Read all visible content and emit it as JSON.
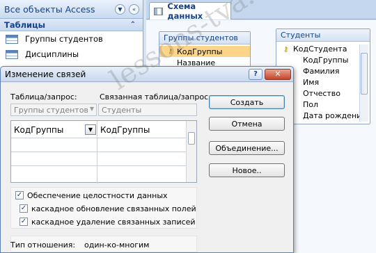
{
  "nav": {
    "header_title": "Все объекты Access",
    "section_title": "Таблицы",
    "items": [
      {
        "label": "Группы студентов"
      },
      {
        "label": "Дисциплины"
      }
    ]
  },
  "document": {
    "tab_label": "Схема данных",
    "field_lists": [
      {
        "title": "Группы студентов",
        "fields": [
          "КодГруппы",
          "Название"
        ],
        "key_field": "КодГруппы"
      },
      {
        "title": "Студенты",
        "fields": [
          "КодСтудента",
          "КодГруппы",
          "Фамилия",
          "Имя",
          "Отчество",
          "Пол",
          "Дата рождения"
        ],
        "key_field": "КодСтудента"
      }
    ]
  },
  "dialog": {
    "title": "Изменение связей",
    "help_label": "?",
    "close_label": "✕",
    "table_label": "Таблица/запрос:",
    "related_label": "Связанная таблица/запрос:",
    "table_value": "Группы студентов",
    "related_value": "Студенты",
    "grid_rows": [
      {
        "left": "КодГруппы",
        "right": "КодГруппы"
      }
    ],
    "checkboxes": [
      {
        "label": "Обеспечение целостности данных",
        "checked": true
      },
      {
        "label": "каскадное обновление связанных полей",
        "checked": true
      },
      {
        "label": "каскадное удаление связанных записей",
        "checked": true
      }
    ],
    "relation_type_label": "Тип отношения:",
    "relation_type_value": "один-ко-многим",
    "buttons": {
      "create": "Создать",
      "cancel": "Отмена",
      "join": "Объединение...",
      "new": "Новое.."
    }
  },
  "watermark": "lessons-tva.info",
  "icons": {
    "nav_menu": "chevron-down-icon",
    "nav_collapse": "chevron-left-icon",
    "section_collapse": "double-chevron-up-icon",
    "table": "table-icon",
    "key": "key-icon",
    "check": "checkmark-icon",
    "dropdown": "dropdown-arrow-icon"
  }
}
